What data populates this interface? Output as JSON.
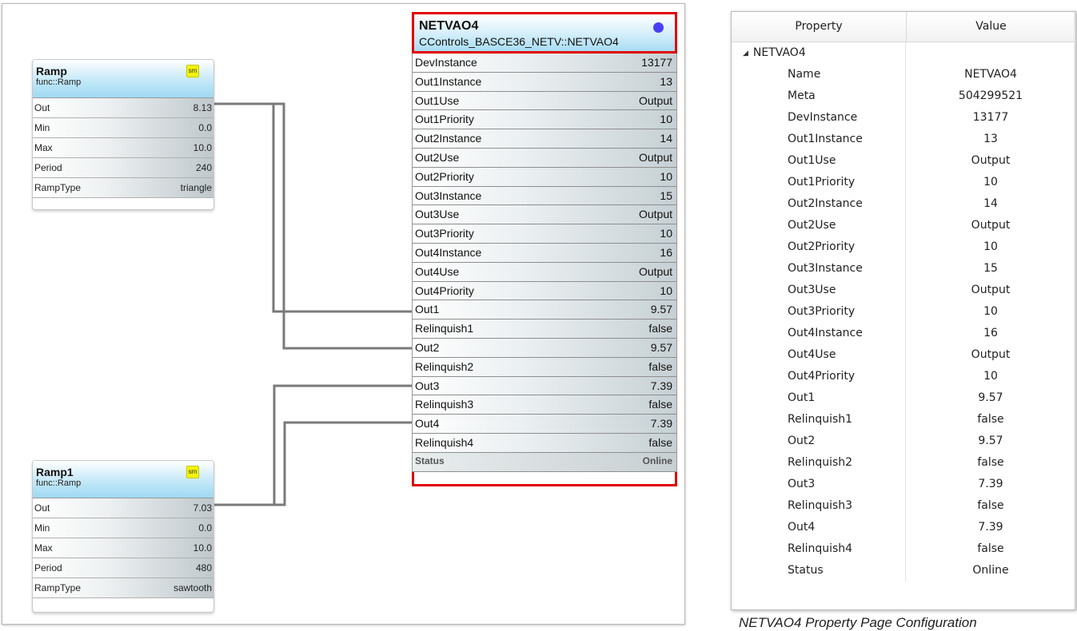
{
  "ramp_blocks": [
    {
      "title": "Ramp",
      "type": "func::Ramp",
      "badge": "sm",
      "rows": [
        {
          "k": "Out",
          "v": "8.13"
        },
        {
          "k": "Min",
          "v": "0.0"
        },
        {
          "k": "Max",
          "v": "10.0"
        },
        {
          "k": "Period",
          "v": "240"
        },
        {
          "k": "RampType",
          "v": "triangle"
        }
      ]
    },
    {
      "title": "Ramp1",
      "type": "func::Ramp",
      "badge": "sm",
      "rows": [
        {
          "k": "Out",
          "v": "7.03"
        },
        {
          "k": "Min",
          "v": "0.0"
        },
        {
          "k": "Max",
          "v": "10.0"
        },
        {
          "k": "Period",
          "v": "480"
        },
        {
          "k": "RampType",
          "v": "sawtooth"
        }
      ]
    }
  ],
  "netvao": {
    "title": "NETVAO4",
    "type": "CControls_BASCE36_NETV::NETVAO4",
    "rows": [
      {
        "k": "DevInstance",
        "v": "13177"
      },
      {
        "k": "Out1Instance",
        "v": "13"
      },
      {
        "k": "Out1Use",
        "v": "Output"
      },
      {
        "k": "Out1Priority",
        "v": "10"
      },
      {
        "k": "Out2Instance",
        "v": "14"
      },
      {
        "k": "Out2Use",
        "v": "Output"
      },
      {
        "k": "Out2Priority",
        "v": "10"
      },
      {
        "k": "Out3Instance",
        "v": "15"
      },
      {
        "k": "Out3Use",
        "v": "Output"
      },
      {
        "k": "Out3Priority",
        "v": "10"
      },
      {
        "k": "Out4Instance",
        "v": "16"
      },
      {
        "k": "Out4Use",
        "v": "Output"
      },
      {
        "k": "Out4Priority",
        "v": "10"
      },
      {
        "k": "Out1",
        "v": "9.57"
      },
      {
        "k": "Relinquish1",
        "v": "false"
      },
      {
        "k": "Out2",
        "v": "9.57"
      },
      {
        "k": "Relinquish2",
        "v": "false"
      },
      {
        "k": "Out3",
        "v": "7.39"
      },
      {
        "k": "Relinquish3",
        "v": "false"
      },
      {
        "k": "Out4",
        "v": "7.39"
      },
      {
        "k": "Relinquish4",
        "v": "false"
      },
      {
        "k": "Status",
        "v": "Online"
      }
    ]
  },
  "property_panel": {
    "col_property": "Property",
    "col_value": "Value",
    "root": "NETVAO4",
    "rows": [
      {
        "k": "Name",
        "v": "NETVAO4"
      },
      {
        "k": "Meta",
        "v": "504299521"
      },
      {
        "k": "DevInstance",
        "v": "13177"
      },
      {
        "k": "Out1Instance",
        "v": "13"
      },
      {
        "k": "Out1Use",
        "v": "Output"
      },
      {
        "k": "Out1Priority",
        "v": "10"
      },
      {
        "k": "Out2Instance",
        "v": "14"
      },
      {
        "k": "Out2Use",
        "v": "Output"
      },
      {
        "k": "Out2Priority",
        "v": "10"
      },
      {
        "k": "Out3Instance",
        "v": "15"
      },
      {
        "k": "Out3Use",
        "v": "Output"
      },
      {
        "k": "Out3Priority",
        "v": "10"
      },
      {
        "k": "Out4Instance",
        "v": "16"
      },
      {
        "k": "Out4Use",
        "v": "Output"
      },
      {
        "k": "Out4Priority",
        "v": "10"
      },
      {
        "k": "Out1",
        "v": "9.57"
      },
      {
        "k": "Relinquish1",
        "v": "false"
      },
      {
        "k": "Out2",
        "v": "9.57"
      },
      {
        "k": "Relinquish2",
        "v": "false"
      },
      {
        "k": "Out3",
        "v": "7.39"
      },
      {
        "k": "Relinquish3",
        "v": "false"
      },
      {
        "k": "Out4",
        "v": "7.39"
      },
      {
        "k": "Relinquish4",
        "v": "false"
      },
      {
        "k": "Status",
        "v": "Online"
      }
    ]
  },
  "caption": "NETVAO4 Property Page Configuration",
  "colors": {
    "selection_border": "#e00000",
    "status_dot": "#4b3ff5",
    "badge": "#f2f20a",
    "wire": "#7a7a7a"
  }
}
